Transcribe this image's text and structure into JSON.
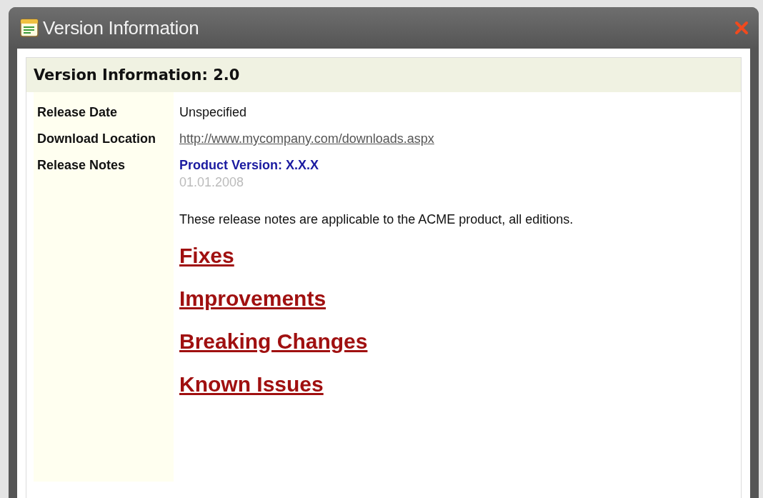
{
  "window": {
    "title": "Version Information"
  },
  "panel": {
    "title": "Version Information: 2.0",
    "fields": [
      {
        "label": "Release Date",
        "kind": "text",
        "value": "Unspecified"
      },
      {
        "label": "Download Location",
        "kind": "link",
        "value": "http://www.mycompany.com/downloads.aspx"
      },
      {
        "label": "Release Notes",
        "kind": "notes",
        "value": "Product Version: X.X.X"
      }
    ],
    "notes": {
      "date": "01.01.2008",
      "summary": "These release notes are applicable to the ACME product, all editions.",
      "sections": [
        "Fixes",
        "Improvements",
        "Breaking Changes",
        "Known Issues"
      ]
    }
  }
}
